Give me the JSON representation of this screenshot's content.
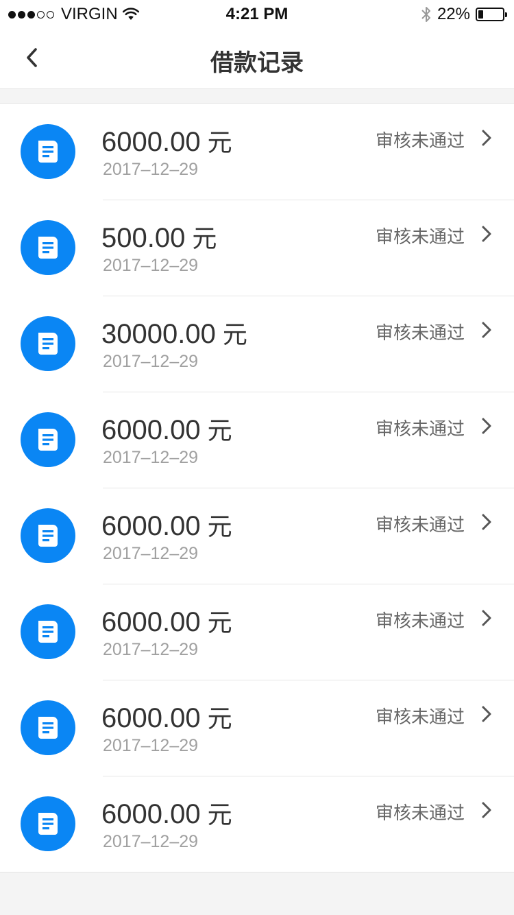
{
  "status_bar": {
    "carrier": "VIRGIN",
    "time": "4:21 PM",
    "battery": "22%",
    "battery_level": 0.22,
    "icons": [
      "signal-icon",
      "wifi-icon",
      "bluetooth-icon",
      "battery-icon"
    ]
  },
  "nav": {
    "title": "借款记录",
    "back_icon": "chevron-left-icon"
  },
  "records": [
    {
      "amount": "6000.00",
      "unit": "元",
      "date": "2017–12–29",
      "status": "审核未通过"
    },
    {
      "amount": "500.00",
      "unit": "元",
      "date": "2017–12–29",
      "status": "审核未通过"
    },
    {
      "amount": "30000.00",
      "unit": "元",
      "date": "2017–12–29",
      "status": "审核未通过"
    },
    {
      "amount": "6000.00",
      "unit": "元",
      "date": "2017–12–29",
      "status": "审核未通过"
    },
    {
      "amount": "6000.00",
      "unit": "元",
      "date": "2017–12–29",
      "status": "审核未通过"
    },
    {
      "amount": "6000.00",
      "unit": "元",
      "date": "2017–12–29",
      "status": "审核未通过"
    },
    {
      "amount": "6000.00",
      "unit": "元",
      "date": "2017–12–29",
      "status": "审核未通过"
    },
    {
      "amount": "6000.00",
      "unit": "元",
      "date": "2017–12–29",
      "status": "审核未通过"
    }
  ],
  "colors": {
    "accent": "#0a86f4",
    "background": "#f4f4f4"
  }
}
